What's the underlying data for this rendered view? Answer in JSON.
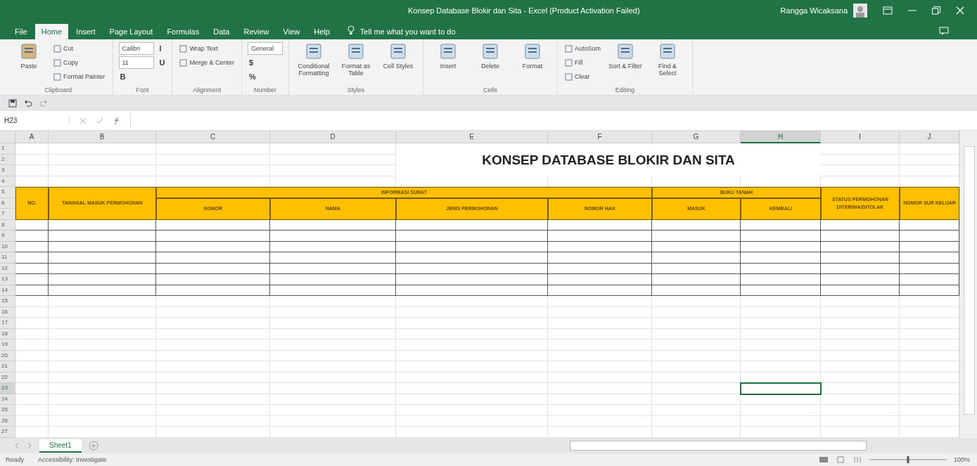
{
  "window": {
    "title": "Konsep Database Blokir dan Sita - Excel (Product Activation Failed)",
    "user": "Rangga Wicaksana"
  },
  "tabs": [
    {
      "label": "File",
      "selected": false
    },
    {
      "label": "Home",
      "selected": true
    },
    {
      "label": "Insert",
      "selected": false
    },
    {
      "label": "Page Layout",
      "selected": false
    },
    {
      "label": "Formulas",
      "selected": false
    },
    {
      "label": "Data",
      "selected": false
    },
    {
      "label": "Review",
      "selected": false
    },
    {
      "label": "View",
      "selected": false
    },
    {
      "label": "Help",
      "selected": false
    }
  ],
  "tell_me": {
    "placeholder": "Tell me what you want to do"
  },
  "ribbon": [
    {
      "label": "Clipboard",
      "commands": [
        {
          "kind": "large",
          "label": "Paste"
        },
        {
          "kind": "small",
          "label": "Cut"
        },
        {
          "kind": "small",
          "label": "Copy"
        },
        {
          "kind": "small",
          "label": "Format Painter"
        }
      ]
    },
    {
      "label": "Font",
      "commands": [
        {
          "kind": "field",
          "label": "Calibri"
        },
        {
          "kind": "field",
          "label": "11"
        },
        {
          "kind": "glyph",
          "label": "B"
        },
        {
          "kind": "glyph",
          "label": "I"
        },
        {
          "kind": "glyph",
          "label": "U"
        }
      ]
    },
    {
      "label": "Alignment",
      "commands": [
        {
          "kind": "small",
          "label": "Wrap Text"
        },
        {
          "kind": "small",
          "label": "Merge & Center"
        }
      ]
    },
    {
      "label": "Number",
      "commands": [
        {
          "kind": "field",
          "label": "General"
        },
        {
          "kind": "glyph",
          "label": "$"
        },
        {
          "kind": "glyph",
          "label": "%"
        }
      ]
    },
    {
      "label": "Styles",
      "commands": [
        {
          "kind": "large",
          "label": "Conditional Formatting"
        },
        {
          "kind": "large",
          "label": "Format as Table"
        },
        {
          "kind": "large",
          "label": "Cell Styles"
        }
      ]
    },
    {
      "label": "Cells",
      "commands": [
        {
          "kind": "large",
          "label": "Insert"
        },
        {
          "kind": "large",
          "label": "Delete"
        },
        {
          "kind": "large",
          "label": "Format"
        }
      ]
    },
    {
      "label": "Editing",
      "commands": [
        {
          "kind": "small",
          "label": "AutoSum"
        },
        {
          "kind": "small",
          "label": "Fill"
        },
        {
          "kind": "small",
          "label": "Clear"
        },
        {
          "kind": "large",
          "label": "Sort & Filter"
        },
        {
          "kind": "large",
          "label": "Find & Select"
        }
      ]
    }
  ],
  "formula_bar": {
    "name_box": "H23"
  },
  "sheet": {
    "columns": [
      {
        "label": "A",
        "selected": false
      },
      {
        "label": "B",
        "selected": false
      },
      {
        "label": "C",
        "selected": false
      },
      {
        "label": "D",
        "selected": false
      },
      {
        "label": "E",
        "selected": false
      },
      {
        "label": "F",
        "selected": false
      },
      {
        "label": "G",
        "selected": false
      },
      {
        "label": "H",
        "selected": true
      },
      {
        "label": "I",
        "selected": false
      },
      {
        "label": "J",
        "selected": false
      }
    ],
    "rows": [
      {
        "label": "1",
        "selected": false,
        "bordered": false
      },
      {
        "label": "2",
        "selected": false,
        "bordered": false
      },
      {
        "label": "3",
        "selected": false,
        "bordered": false
      },
      {
        "label": "4",
        "selected": false,
        "bordered": false
      },
      {
        "label": "5",
        "selected": false
      },
      {
        "label": "6",
        "selected": false
      },
      {
        "label": "7",
        "selected": false
      },
      {
        "label": "8",
        "selected": false,
        "bordered": true
      },
      {
        "label": "9",
        "selected": false,
        "bordered": true
      },
      {
        "label": "10",
        "selected": false,
        "bordered": true
      },
      {
        "label": "11",
        "selected": false,
        "bordered": true
      },
      {
        "label": "12",
        "selected": false,
        "bordered": true
      },
      {
        "label": "13",
        "selected": false,
        "bordered": true
      },
      {
        "label": "14",
        "selected": false,
        "bordered": true
      },
      {
        "label": "15",
        "selected": false,
        "bordered": false
      },
      {
        "label": "16",
        "selected": false,
        "bordered": false
      },
      {
        "label": "17",
        "selected": false,
        "bordered": false
      },
      {
        "label": "18",
        "selected": false,
        "bordered": false
      },
      {
        "label": "19",
        "selected": false,
        "bordered": false
      },
      {
        "label": "20",
        "selected": false,
        "bordered": false
      },
      {
        "label": "21",
        "selected": false,
        "bordered": false
      },
      {
        "label": "22",
        "selected": false,
        "bordered": false
      },
      {
        "label": "23",
        "selected": true,
        "bordered": false
      },
      {
        "label": "24",
        "selected": false,
        "bordered": false
      },
      {
        "label": "25",
        "selected": false,
        "bordered": false
      },
      {
        "label": "26",
        "selected": false,
        "bordered": false
      },
      {
        "label": "27",
        "selected": false,
        "bordered": false
      }
    ],
    "title": "KONSEP DATABASE BLOKIR DAN SITA",
    "header": [
      {
        "kind": "single",
        "label": "NO."
      },
      {
        "kind": "single",
        "label": "TANGGAL MASUK PERMOHONAN"
      },
      {
        "kind": "group",
        "label": "INFORMASI SURAT",
        "columns": [
          "NOMOR",
          "NAMA",
          "JENIS PERMOHONAN",
          "NOMOR HAK"
        ]
      },
      {
        "kind": "group",
        "label": "BUKU TANAH",
        "columns": [
          "MASUK",
          "KEMBALI"
        ]
      },
      {
        "kind": "single",
        "label": "STATUS PERMOHONAN DITERIMA/DITOLAK"
      },
      {
        "kind": "single",
        "label": "NOMOR SUR KELUAR"
      }
    ]
  },
  "sheet_tabs": [
    {
      "label": "Sheet1",
      "selected": true
    }
  ],
  "status_bar": {
    "mode": "Ready",
    "accessibility": "Accessibility: Investigate",
    "zoom": "100%",
    "zoom_slider": {
      "level": 0.5
    }
  }
}
